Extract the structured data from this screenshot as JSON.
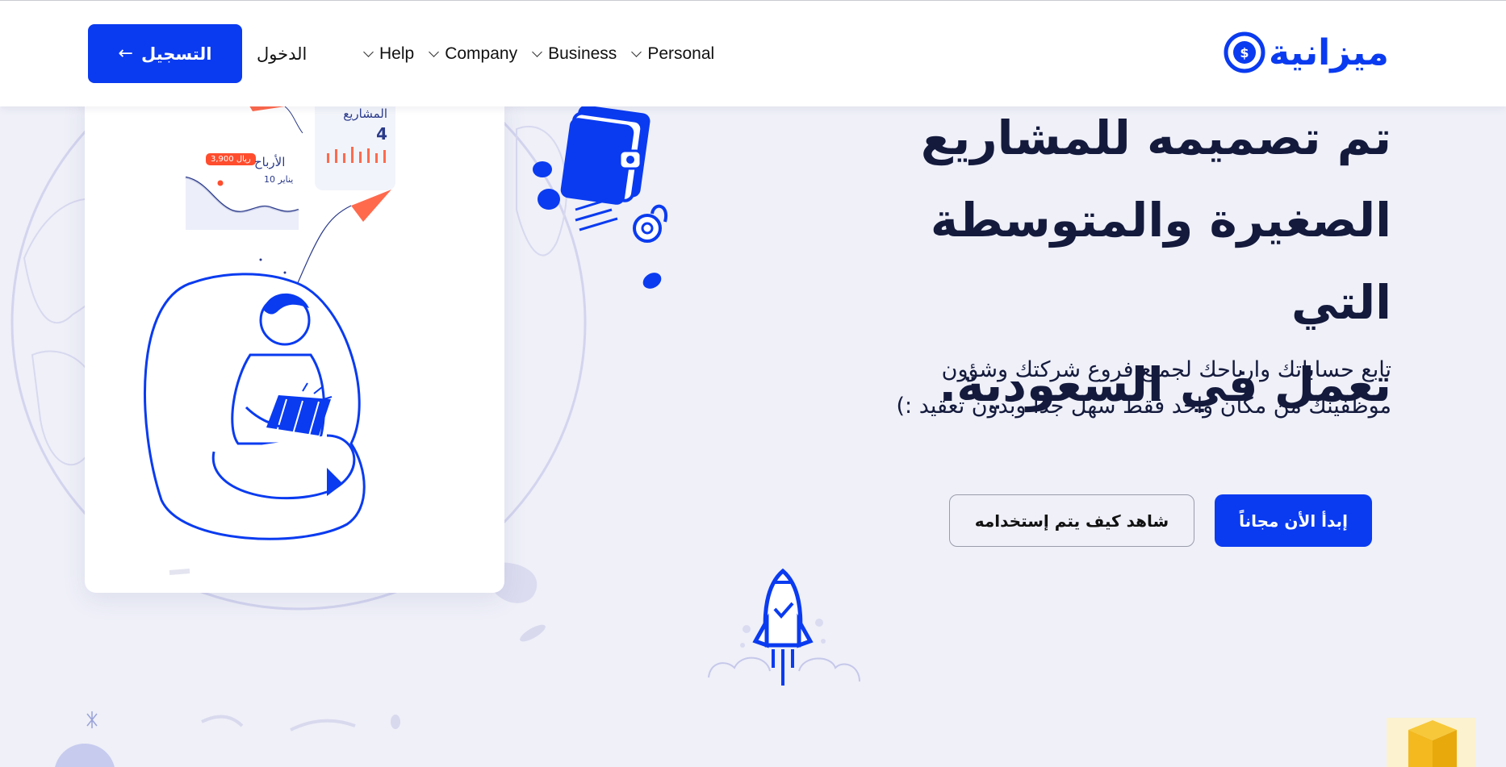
{
  "header": {
    "logo_text": "ميزانية",
    "nav": [
      {
        "label": "Personal"
      },
      {
        "label": "Business"
      },
      {
        "label": "Company"
      },
      {
        "label": "Help"
      }
    ],
    "login_label": "الدخول",
    "register_label": "التسجيل"
  },
  "hero": {
    "title_lines": [
      "تم تصميمه للمشاريع",
      "الصغيرة والمتوسطة التي",
      "تعمل في السعودية."
    ],
    "subtitle": "تابع حساباتك وارباحك لجميع فروع شركتك وشؤون موظفينك من مكان واحد فقط سهل جداً وبدون تعقيد :)",
    "cta_primary": "إبدأ الأن مجاناً",
    "cta_secondary": "شاهد كيف يتم إستخدامه"
  },
  "card": {
    "projects_label": "المشاريع",
    "projects_value": "4",
    "profit_label": "الأرباح",
    "profit_date": "10 يناير",
    "profit_badge": "3,900 ريال"
  },
  "colors": {
    "brand": "#0a3bf0",
    "background": "#eff0f8",
    "text": "#141a3c",
    "accent": "#ff4d2e"
  }
}
